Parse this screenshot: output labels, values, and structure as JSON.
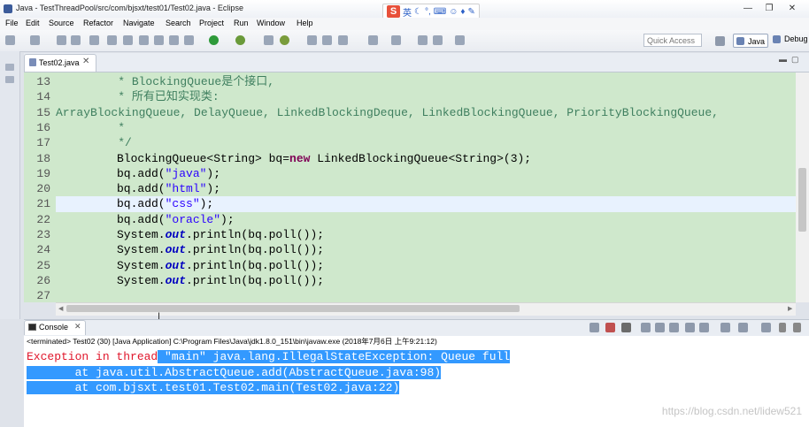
{
  "window": {
    "title": "Java - TestThreadPool/src/com/bjsxt/test01/Test02.java - Eclipse",
    "minimize": "—",
    "maximize": "❐",
    "close": "✕"
  },
  "ime": {
    "logo": "S",
    "lang": "英",
    "icons": [
      "moon-icon",
      "comma-icon",
      "keyboard-icon",
      "skin-icon",
      "shirt-icon",
      "wrench-icon"
    ]
  },
  "menu": [
    "File",
    "Edit",
    "Source",
    "Refactor",
    "Navigate",
    "Search",
    "Project",
    "Run",
    "Window",
    "Help"
  ],
  "quick_access": {
    "placeholder": "Quick Access"
  },
  "perspectives": {
    "java": "Java",
    "debug": "Debug"
  },
  "editor": {
    "tab_label": "Test02.java",
    "lines": [
      {
        "num": "13",
        "text": "         * BlockingQueue是个接口,",
        "kind": "comment"
      },
      {
        "num": "14",
        "text": "         * 所有已知实现类:",
        "kind": "comment"
      },
      {
        "num": "15",
        "text": "ArrayBlockingQueue, DelayQueue, LinkedBlockingDeque, LinkedBlockingQueue, PriorityBlockingQueue,",
        "kind": "comment"
      },
      {
        "num": "16",
        "text": "         *",
        "kind": "comment"
      },
      {
        "num": "17",
        "text": "         */",
        "kind": "comment"
      },
      {
        "num": "18",
        "text": "BlockingQueue<String> bq=new LinkedBlockingQueue<String>(3);"
      },
      {
        "num": "19",
        "text": "bq.add(\"java\");"
      },
      {
        "num": "20",
        "text": "bq.add(\"html\");"
      },
      {
        "num": "21",
        "text": "bq.add(\"css\");"
      },
      {
        "num": "22",
        "text": "bq.add(\"oracle\");"
      },
      {
        "num": "23",
        "text": "System.out.println(bq.poll());"
      },
      {
        "num": "24",
        "text": "System.out.println(bq.poll());"
      },
      {
        "num": "25",
        "text": "System.out.println(bq.poll());"
      },
      {
        "num": "26",
        "text": "System.out.println(bq.poll());"
      },
      {
        "num": "27",
        "text": ""
      }
    ]
  },
  "console": {
    "tab_label": "Console",
    "status": "<terminated> Test02 (30) [Java Application] C:\\Program Files\\Java\\jdk1.8.0_151\\bin\\javaw.exe (2018年7月6日 上午9:21:12)",
    "output": [
      "Exception in thread \"main\" java.lang.IllegalStateException: Queue full",
      "\tat java.util.AbstractQueue.add(AbstractQueue.java:98)",
      "\tat com.bjsxt.test01.Test02.main(Test02.java:22)"
    ]
  },
  "watermark": "https://blog.csdn.net/lidew521",
  "colors": {
    "editor_bg": "#cfe8cc",
    "comment": "#3f7f5f",
    "keyword": "#7f0055",
    "string": "#2a00ff",
    "error": "#e0162b",
    "selection": "#3399ff"
  }
}
